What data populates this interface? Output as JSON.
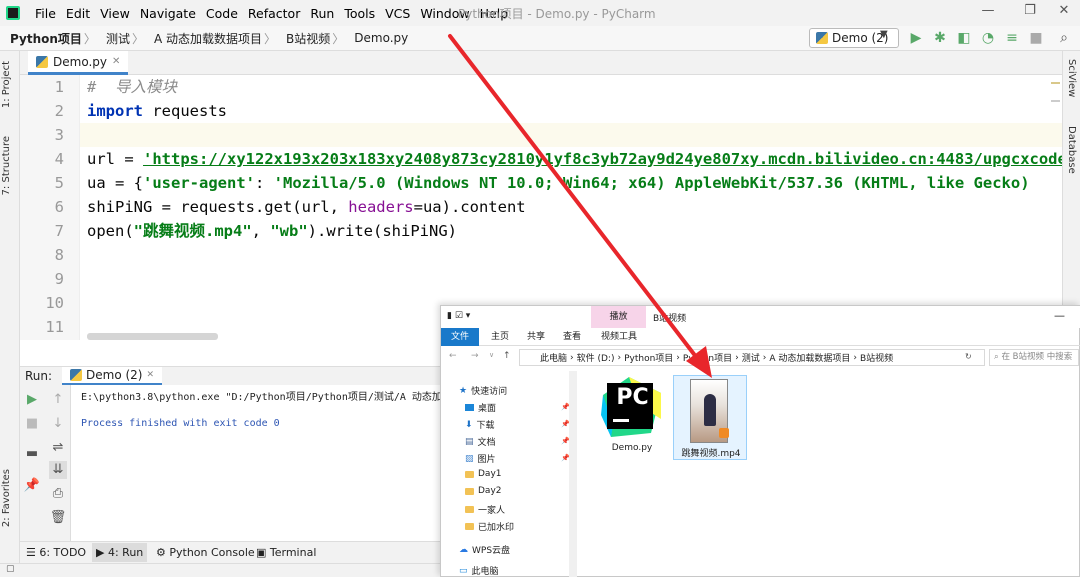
{
  "menubar": {
    "items": [
      "File",
      "Edit",
      "View",
      "Navigate",
      "Code",
      "Refactor",
      "Run",
      "Tools",
      "VCS",
      "Window",
      "Help"
    ],
    "title": "Python项目 - Demo.py - PyCharm"
  },
  "breadcrumb": [
    "Python项目",
    "测试",
    "A 动态加载数据项目",
    "B站视频",
    "Demo.py"
  ],
  "toolbar": {
    "run_config": "Demo (2)"
  },
  "left_tabs": {
    "project": "1: Project",
    "structure": "7: Structure",
    "favorites": "2: Favorites"
  },
  "right_tabs": {
    "sciview": "SciView",
    "database": "Database"
  },
  "editor": {
    "tab": "Demo.py",
    "line_numbers": [
      "1",
      "2",
      "3",
      "4",
      "5",
      "6",
      "7",
      "8",
      "9",
      "10",
      "11"
    ],
    "lines": {
      "l1": "#  导入模块",
      "l2_kw": "import",
      "l2_rest": " requests",
      "l4_a": "url = ",
      "l4_url": "'https://xy122x193x203x183xy2408y873cy2810y1yf8c3yb72ay9d24ye807xy.mcdn.bilivideo.cn:4483/upgcxcode",
      "l5_a": "ua = {",
      "l5_key": "'user-agent'",
      "l5_b": ": ",
      "l5_val": "'Mozilla/5.0 (Windows NT 10.0; Win64; x64) AppleWebKit/537.36 (KHTML, like Gecko)",
      "l6_a": "shiPiNG = requests.get(url, ",
      "l6_param": "headers",
      "l6_b": "=ua).content",
      "l7_a": "open(",
      "l7_s1": "\"跳舞视频.mp4\"",
      "l7_b": ", ",
      "l7_s2": "\"wb\"",
      "l7_c": ").write(shiPiNG)"
    }
  },
  "run_panel": {
    "label": "Run:",
    "tab": "Demo (2)",
    "console": [
      "E:\\python3.8\\python.exe \"D:/Python项目/Python项目/测试/A 动态加载数据",
      "Process finished with exit code 0"
    ]
  },
  "bottom_tabs": {
    "todo": "6: TODO",
    "run": "4: Run",
    "python_console": "Python Console",
    "terminal": "Terminal"
  },
  "explorer": {
    "title": "B站视频",
    "context_tab": "播放",
    "ribbon_tabs": [
      "文件",
      "主页",
      "共享",
      "查看",
      "视频工具"
    ],
    "path": [
      "此电脑",
      "软件 (D:)",
      "Python项目",
      "Python项目",
      "测试",
      "A 动态加载数据项目",
      "B站视频"
    ],
    "search_placeholder": "在 B站视频 中搜索",
    "nav": [
      "快速访问",
      "桌面",
      "下载",
      "文档",
      "图片",
      "Day1",
      "Day2",
      "一家人",
      "已加水印",
      "WPS云盘",
      "此电脑"
    ],
    "files": [
      {
        "name": "Demo.py",
        "icon": "pycharm-icon"
      },
      {
        "name": "跳舞视频.mp4",
        "icon": "video-thumbnail"
      }
    ]
  },
  "colors": {
    "accent": "#4083c9",
    "keyword": "#0033b3",
    "string": "#067d17",
    "arrow": "#e8262b",
    "run_green": "#59a869"
  }
}
